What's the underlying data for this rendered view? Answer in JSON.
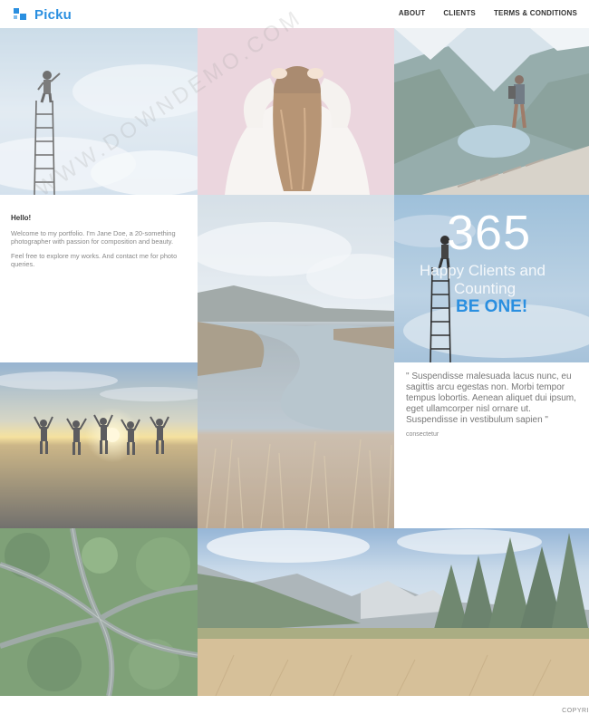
{
  "header": {
    "logo_text": "Picku",
    "nav": [
      {
        "label": "ABOUT"
      },
      {
        "label": "CLIENTS"
      },
      {
        "label": "TERMS & CONDITIONS"
      }
    ]
  },
  "intro": {
    "heading": "Hello!",
    "paragraph1": "Welcome to my portfolio. I'm Jane Doe, a 20-something photographer with passion for composition and beauty.",
    "paragraph2": "Feel free to explore my works. And contact me for photo queries."
  },
  "counter": {
    "number": "365",
    "line1": "Happy Clients and",
    "line2": "Counting",
    "cta": "BE ONE!"
  },
  "quote": {
    "text": "\" Suspendisse malesuada lacus nunc, eu sagittis arcu egestas non. Morbi tempor tempus lobortis. Aenean aliquet dui ipsum, eget ullamcorper nisl ornare ut. Suspendisse in vestibulum sapien \"",
    "cite": "consectetur"
  },
  "footer": {
    "copyright": "COPYRI"
  },
  "watermark": "WWW.DOWNDEMO.COM",
  "colors": {
    "accent": "#2a8fe0",
    "nav_text": "#333333",
    "body_text": "#888888"
  }
}
